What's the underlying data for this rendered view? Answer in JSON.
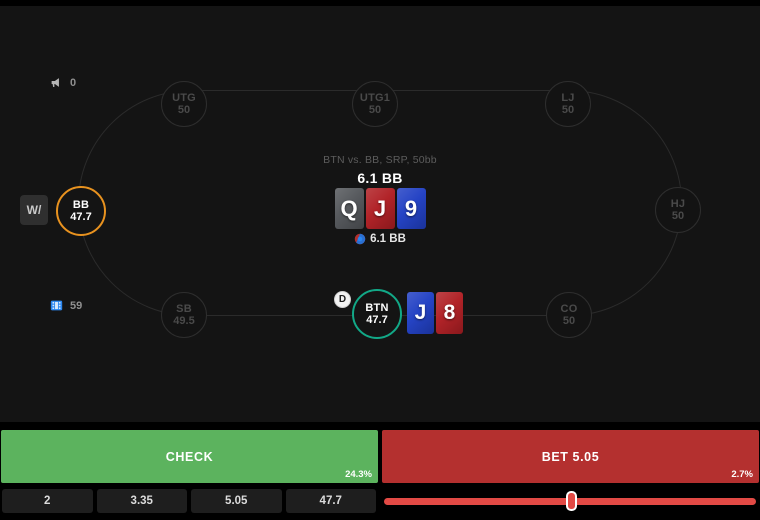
{
  "hud": {
    "megaphone_icon": "megaphone-icon",
    "megaphone_count": "0",
    "video_icon": "video-icon",
    "video_count": "59"
  },
  "table": {
    "hand_label": "BTN vs. BB, SRP, 50bb",
    "pot_top": "6.1 BB",
    "pot_bottom": "6.1 BB",
    "chip_icon": "poker-chip-icon",
    "dealer_button": "D",
    "w_badge": "W/",
    "seats": [
      {
        "id": "utg",
        "name": "UTG",
        "stack": "50",
        "state": "folded"
      },
      {
        "id": "utg1",
        "name": "UTG1",
        "stack": "50",
        "state": "folded"
      },
      {
        "id": "lj",
        "name": "LJ",
        "stack": "50",
        "state": "folded"
      },
      {
        "id": "hj",
        "name": "HJ",
        "stack": "50",
        "state": "folded"
      },
      {
        "id": "co",
        "name": "CO",
        "stack": "50",
        "state": "folded"
      },
      {
        "id": "btn",
        "name": "BTN",
        "stack": "47.7",
        "state": "active-hero"
      },
      {
        "id": "sb",
        "name": "SB",
        "stack": "49.5",
        "state": "folded"
      },
      {
        "id": "bb",
        "name": "BB",
        "stack": "47.7",
        "state": "active-villain"
      }
    ],
    "board": [
      {
        "rank": "Q",
        "suit": "s"
      },
      {
        "rank": "J",
        "suit": "h"
      },
      {
        "rank": "9",
        "suit": "d"
      }
    ],
    "hole_cards": [
      {
        "rank": "J",
        "suit": "d"
      },
      {
        "rank": "8",
        "suit": "h"
      }
    ]
  },
  "actions": [
    {
      "id": "check",
      "label": "CHECK",
      "frequency": "24.3%",
      "color": "#5cb35e"
    },
    {
      "id": "bet",
      "label": "BET 5.05",
      "frequency": "2.7%",
      "color": "#b4302f"
    }
  ],
  "bet_sizes": [
    {
      "label": "2"
    },
    {
      "label": "3.35"
    },
    {
      "label": "5.05"
    },
    {
      "label": "47.7"
    }
  ],
  "slider": {
    "position_percent": "49",
    "track_color": "#e24a45"
  }
}
